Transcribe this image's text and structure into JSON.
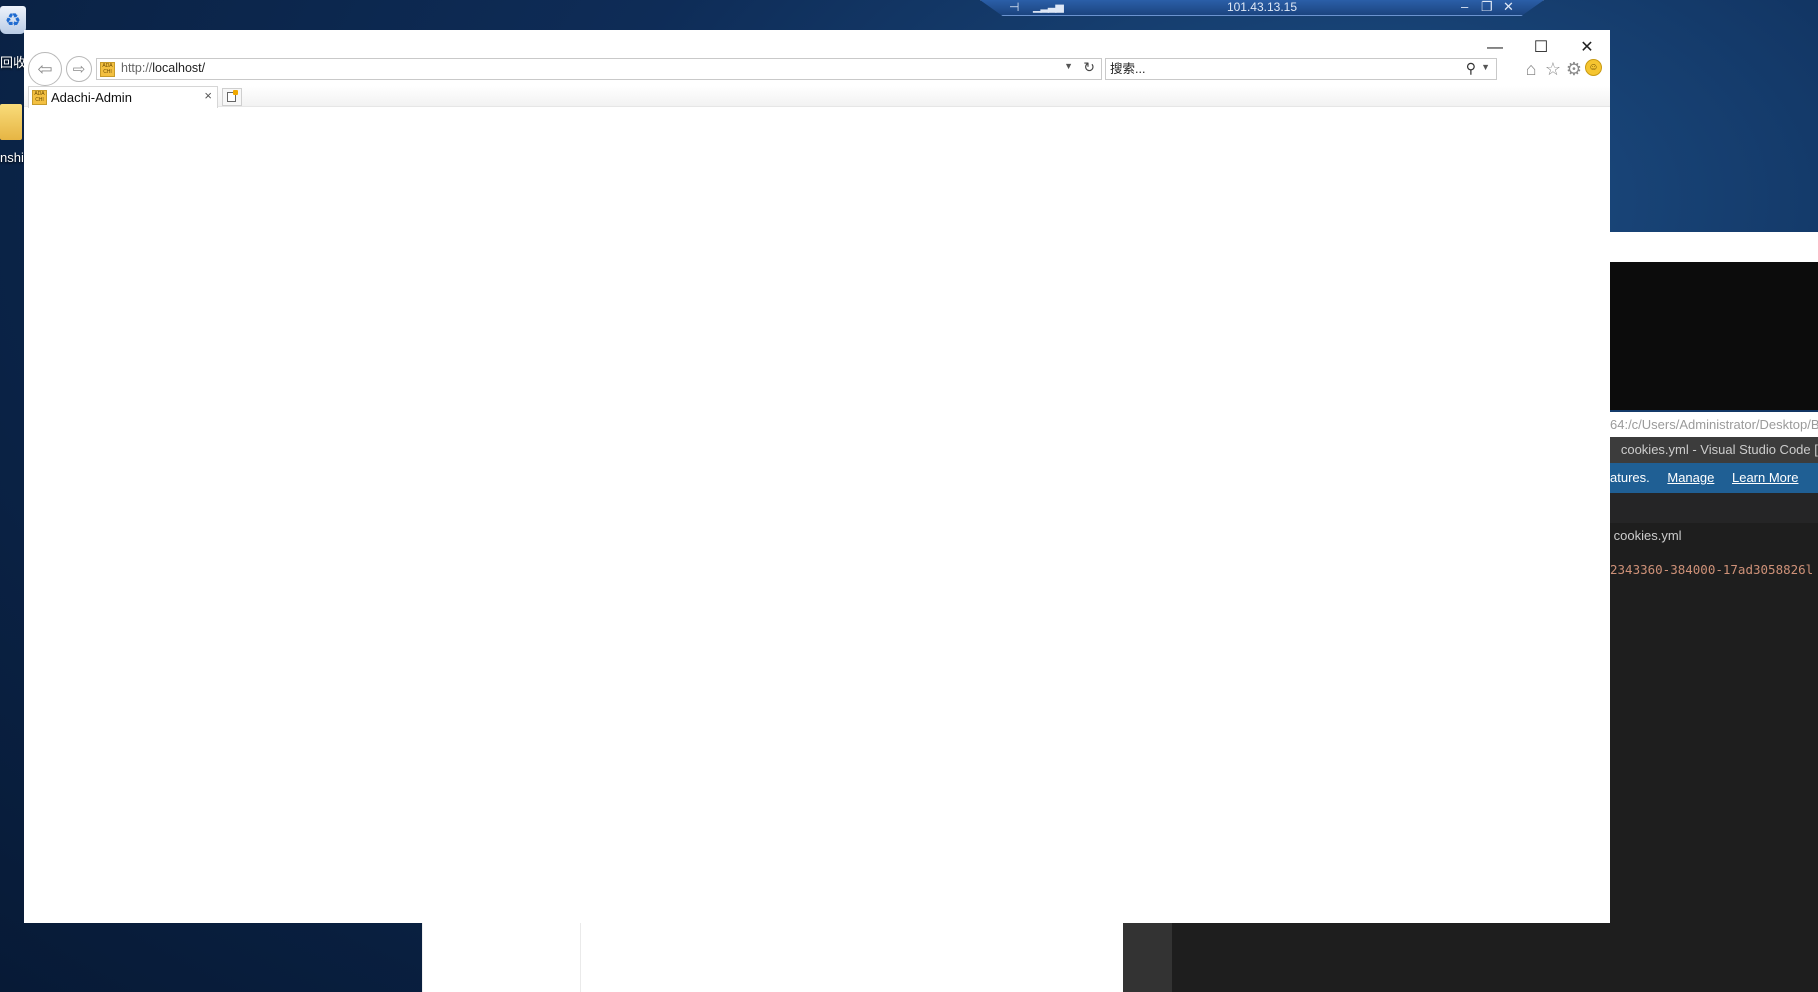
{
  "rdp_bar": {
    "ip": "101.43.13.15",
    "pin_icon": "pin-icon",
    "signal_icon": "signal-icon",
    "minimize_glyph": "–",
    "restore_glyph": "❐",
    "close_glyph": "✕"
  },
  "desktop": {
    "recycle_bin_label": "回收",
    "folder_label": "nshi"
  },
  "browser": {
    "window_controls": {
      "minimize": "—",
      "maximize": "☐",
      "close": "✕"
    },
    "address": {
      "protocol": "http://",
      "host": "localhost/"
    },
    "favicon_text": "ADA CHI",
    "search": {
      "placeholder": "搜索..."
    },
    "tab": {
      "title": "Adachi-Admin",
      "close": "×"
    },
    "toolbar_icons": [
      "home-icon",
      "favorites-star-icon",
      "tools-gear-icon",
      "feedback-smiley-icon"
    ]
  },
  "background": {
    "path_text": "64:/c/Users/Administrator/Desktop/B",
    "vscode_title": "cookies.yml - Visual Studio Code [Ad",
    "banner_text": "atures.",
    "banner_manage": "Manage",
    "banner_learn_more": "Learn More",
    "editor_tab": "cookies.yml",
    "code_line": "2343360-384000-17ad3058826l"
  }
}
